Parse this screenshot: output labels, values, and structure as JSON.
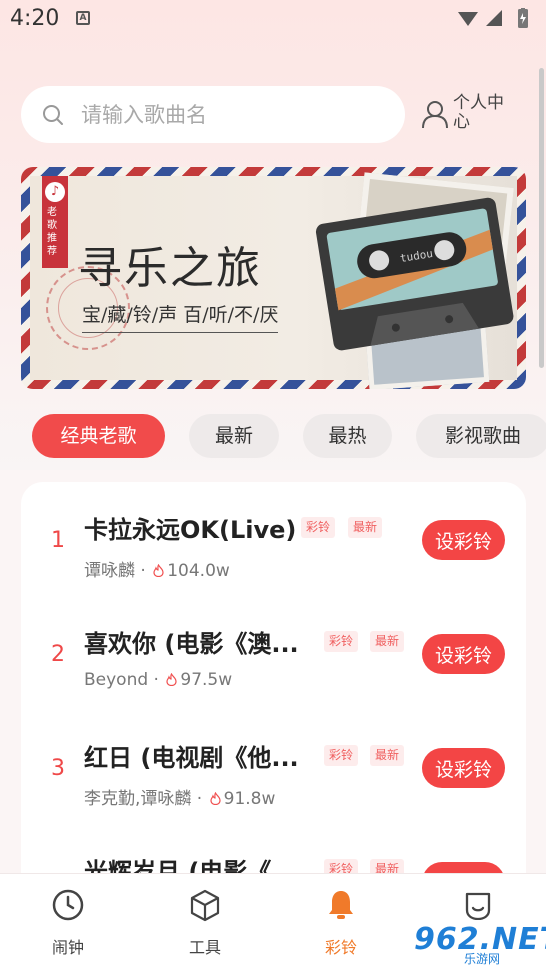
{
  "status_bar": {
    "time": "4:20",
    "notification": "A"
  },
  "search": {
    "placeholder": "请输入歌曲名"
  },
  "profile": {
    "label": "个人中心"
  },
  "banner": {
    "title": "寻乐之旅",
    "subtitle": "宝/藏/铃/声  百/听/不/厌",
    "ribbon_text": "老歌推荐",
    "cassette_label": "tudou"
  },
  "tabs": [
    {
      "label": "经典老歌",
      "active": true
    },
    {
      "label": "最新",
      "active": false
    },
    {
      "label": "最热",
      "active": false
    },
    {
      "label": "影视歌曲",
      "active": false
    }
  ],
  "songs": [
    {
      "rank": "1",
      "title": "卡拉永远OK(Live)",
      "badges": [
        "彩铃",
        "最新"
      ],
      "artist": "谭咏麟",
      "plays": "104.0w",
      "button": "设彩铃"
    },
    {
      "rank": "2",
      "title": "喜欢你 (电影《澳...",
      "badges": [
        "彩铃",
        "最新"
      ],
      "artist": "Beyond",
      "plays": "97.5w",
      "button": "设彩铃"
    },
    {
      "rank": "3",
      "title": "红日 (电视剧《他...",
      "badges": [
        "彩铃",
        "最新"
      ],
      "artist": "李克勤,谭咏麟",
      "plays": "91.8w",
      "button": "设彩铃"
    },
    {
      "rank": "",
      "title": "光辉岁月 (电影《",
      "badges": [
        "彩铃",
        "最新"
      ],
      "artist": "",
      "plays": "",
      "button": ""
    }
  ],
  "bottom_nav": [
    {
      "label": "闹钟",
      "icon": "clock-icon",
      "active": false
    },
    {
      "label": "工具",
      "icon": "box-icon",
      "active": false
    },
    {
      "label": "彩铃",
      "icon": "bell-icon",
      "active": true
    },
    {
      "label": "",
      "icon": "face-icon",
      "active": false
    }
  ],
  "watermark": {
    "brand": "962.NET",
    "sub": "乐游网"
  },
  "colors": {
    "accent": "#f14b4b",
    "nav_active": "#f07a2a"
  }
}
